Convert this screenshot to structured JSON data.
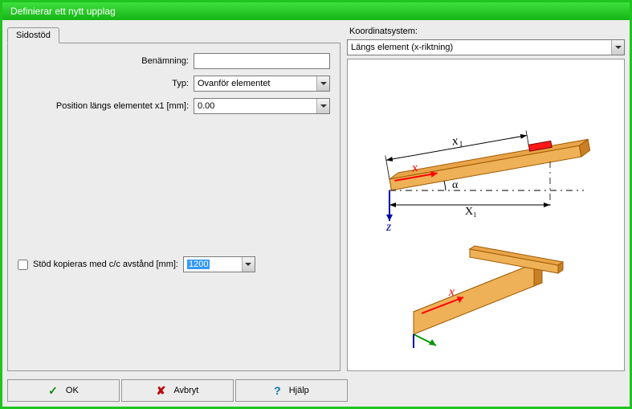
{
  "window": {
    "title": "Definierar ett nytt upplag"
  },
  "tabs": {
    "active": "Sidostöd"
  },
  "form": {
    "name_label": "Benämning:",
    "name_value": "",
    "type_label": "Typ:",
    "type_value": "Ovanför elementet",
    "position_label": "Position längs elementet x1 [mm]:",
    "position_value": "0.00"
  },
  "copy_cc": {
    "label": "Stöd kopieras med c/c avstånd [mm]:",
    "value": "1200",
    "checked": false
  },
  "coord": {
    "label": "Koordinatsystem:",
    "value": "Längs element (x-riktning)"
  },
  "diagram": {
    "x_label": "x",
    "z_label": "z",
    "x1_top_label": "x₁",
    "x1_bottom_label": "X₁",
    "alpha_label": "α"
  },
  "buttons": {
    "ok": "OK",
    "cancel": "Avbryt",
    "help": "Hjälp"
  }
}
